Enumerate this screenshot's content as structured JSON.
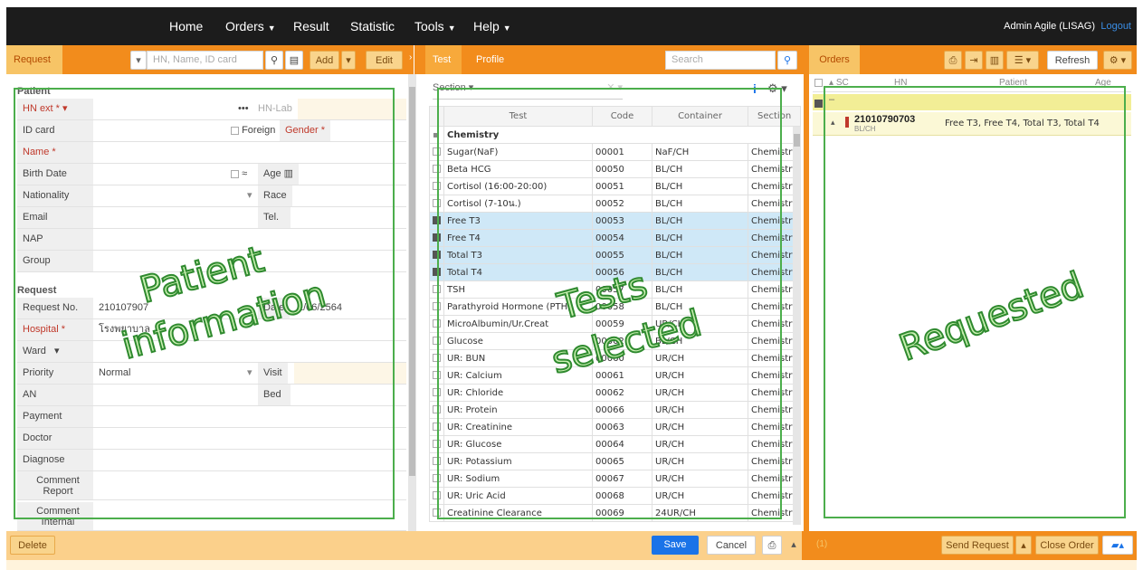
{
  "nav": {
    "items": [
      "Home",
      "Orders",
      "Result",
      "Statistic",
      "Tools",
      "Help"
    ],
    "user": "Admin Agile (LISAG)",
    "logout": "Logout"
  },
  "request_bar": {
    "tab": "Request",
    "search_placeholder": "HN, Name, ID card",
    "add": "Add",
    "edit": "Edit"
  },
  "test_bar": {
    "tabs": [
      "Test",
      "Profile"
    ],
    "search_placeholder": "Search",
    "section_filter": "Section"
  },
  "orders_bar": {
    "tab": "Orders",
    "refresh": "Refresh"
  },
  "patient": {
    "title": "Patient",
    "hn_ext": "HN ext",
    "hn_lab": "HN-Lab",
    "id_card": "ID card",
    "foreign": "Foreign",
    "gender": "Gender",
    "name": "Name",
    "birth_date": "Birth Date",
    "approx": "≈",
    "age": "Age",
    "nationality": "Nationality",
    "race": "Race",
    "email": "Email",
    "tel": "Tel.",
    "nap": "NAP",
    "group": "Group"
  },
  "request": {
    "title": "Request",
    "request_no_label": "Request No.",
    "request_no": "210107907",
    "date_label": "Date",
    "date": "1/06/2564",
    "hospital_label": "Hospital",
    "hospital": "โรงพยาบาล",
    "ward": "Ward",
    "priority_label": "Priority",
    "priority": "Normal",
    "visit": "Visit",
    "an": "AN",
    "bed": "Bed",
    "payment": "Payment",
    "doctor": "Doctor",
    "diagnose": "Diagnose",
    "comment_report": "Comment Report",
    "comment_internal": "Comment Internal"
  },
  "tests": {
    "columns": [
      "Test",
      "Code",
      "Container",
      "Section"
    ],
    "group": "Chemistry",
    "rows": [
      {
        "test": "Sugar(NaF)",
        "code": "00001",
        "container": "NaF/CH",
        "section": "Chemistry",
        "checked": false
      },
      {
        "test": "Beta HCG",
        "code": "00050",
        "container": "BL/CH",
        "section": "Chemistry",
        "checked": false
      },
      {
        "test": "Cortisol (16:00-20:00)",
        "code": "00051",
        "container": "BL/CH",
        "section": "Chemistry",
        "checked": false
      },
      {
        "test": "Cortisol (7-10น.)",
        "code": "00052",
        "container": "BL/CH",
        "section": "Chemistry",
        "checked": false
      },
      {
        "test": "Free T3",
        "code": "00053",
        "container": "BL/CH",
        "section": "Chemistry",
        "checked": true
      },
      {
        "test": "Free T4",
        "code": "00054",
        "container": "BL/CH",
        "section": "Chemistry",
        "checked": true
      },
      {
        "test": "Total T3",
        "code": "00055",
        "container": "BL/CH",
        "section": "Chemistry",
        "checked": true
      },
      {
        "test": "Total T4",
        "code": "00056",
        "container": "BL/CH",
        "section": "Chemistry",
        "checked": true
      },
      {
        "test": "TSH",
        "code": "00057",
        "container": "BL/CH",
        "section": "Chemistry",
        "checked": false
      },
      {
        "test": "Parathyroid Hormone (PTH)",
        "code": "00058",
        "container": "BL/CH",
        "section": "Chemistry",
        "checked": false
      },
      {
        "test": "MicroAlbumin/Ur.Creat",
        "code": "00059",
        "container": "UR/CH",
        "section": "Chemistry",
        "checked": false
      },
      {
        "test": "Glucose",
        "code": "00002",
        "container": "BL/CH",
        "section": "Chemistry",
        "checked": false
      },
      {
        "test": "UR: BUN",
        "code": "00060",
        "container": "UR/CH",
        "section": "Chemistry",
        "checked": false
      },
      {
        "test": "UR: Calcium",
        "code": "00061",
        "container": "UR/CH",
        "section": "Chemistry",
        "checked": false
      },
      {
        "test": "UR: Chloride",
        "code": "00062",
        "container": "UR/CH",
        "section": "Chemistry",
        "checked": false
      },
      {
        "test": "UR: Protein",
        "code": "00066",
        "container": "UR/CH",
        "section": "Chemistry",
        "checked": false
      },
      {
        "test": "UR: Creatinine",
        "code": "00063",
        "container": "UR/CH",
        "section": "Chemistry",
        "checked": false
      },
      {
        "test": "UR: Glucose",
        "code": "00064",
        "container": "UR/CH",
        "section": "Chemistry",
        "checked": false
      },
      {
        "test": "UR: Potassium",
        "code": "00065",
        "container": "UR/CH",
        "section": "Chemistry",
        "checked": false
      },
      {
        "test": "UR: Sodium",
        "code": "00067",
        "container": "UR/CH",
        "section": "Chemistry",
        "checked": false
      },
      {
        "test": "UR: Uric Acid",
        "code": "00068",
        "container": "UR/CH",
        "section": "Chemistry",
        "checked": false
      },
      {
        "test": "Creatinine Clearance",
        "code": "00069",
        "container": "24UR/CH",
        "section": "Chemistry",
        "checked": false
      }
    ]
  },
  "orders": {
    "columns": [
      "SC",
      "HN",
      "Patient",
      "Age"
    ],
    "row": {
      "request_no": "21010790703",
      "container": "BL/CH",
      "tests": "Free T3, Free T4, Total T3, Total T4"
    }
  },
  "footer": {
    "delete": "Delete",
    "save": "Save",
    "cancel": "Cancel",
    "send_request": "Send Request",
    "close_order": "Close Order",
    "count": "(1)"
  },
  "annotations": {
    "patient_line1": "Patient",
    "patient_line2": "information",
    "tests_line1": "Tests",
    "tests_line2": "selected",
    "requested": "Requested"
  },
  "colors": {
    "nav_bg": "#1c1c1c",
    "toolbar_orange": "#f28c1c",
    "footer_light": "#fbd08b",
    "save_blue": "#1a73e8",
    "selected_row": "#cfe8f7",
    "annotation_green": "#4cae4c"
  }
}
